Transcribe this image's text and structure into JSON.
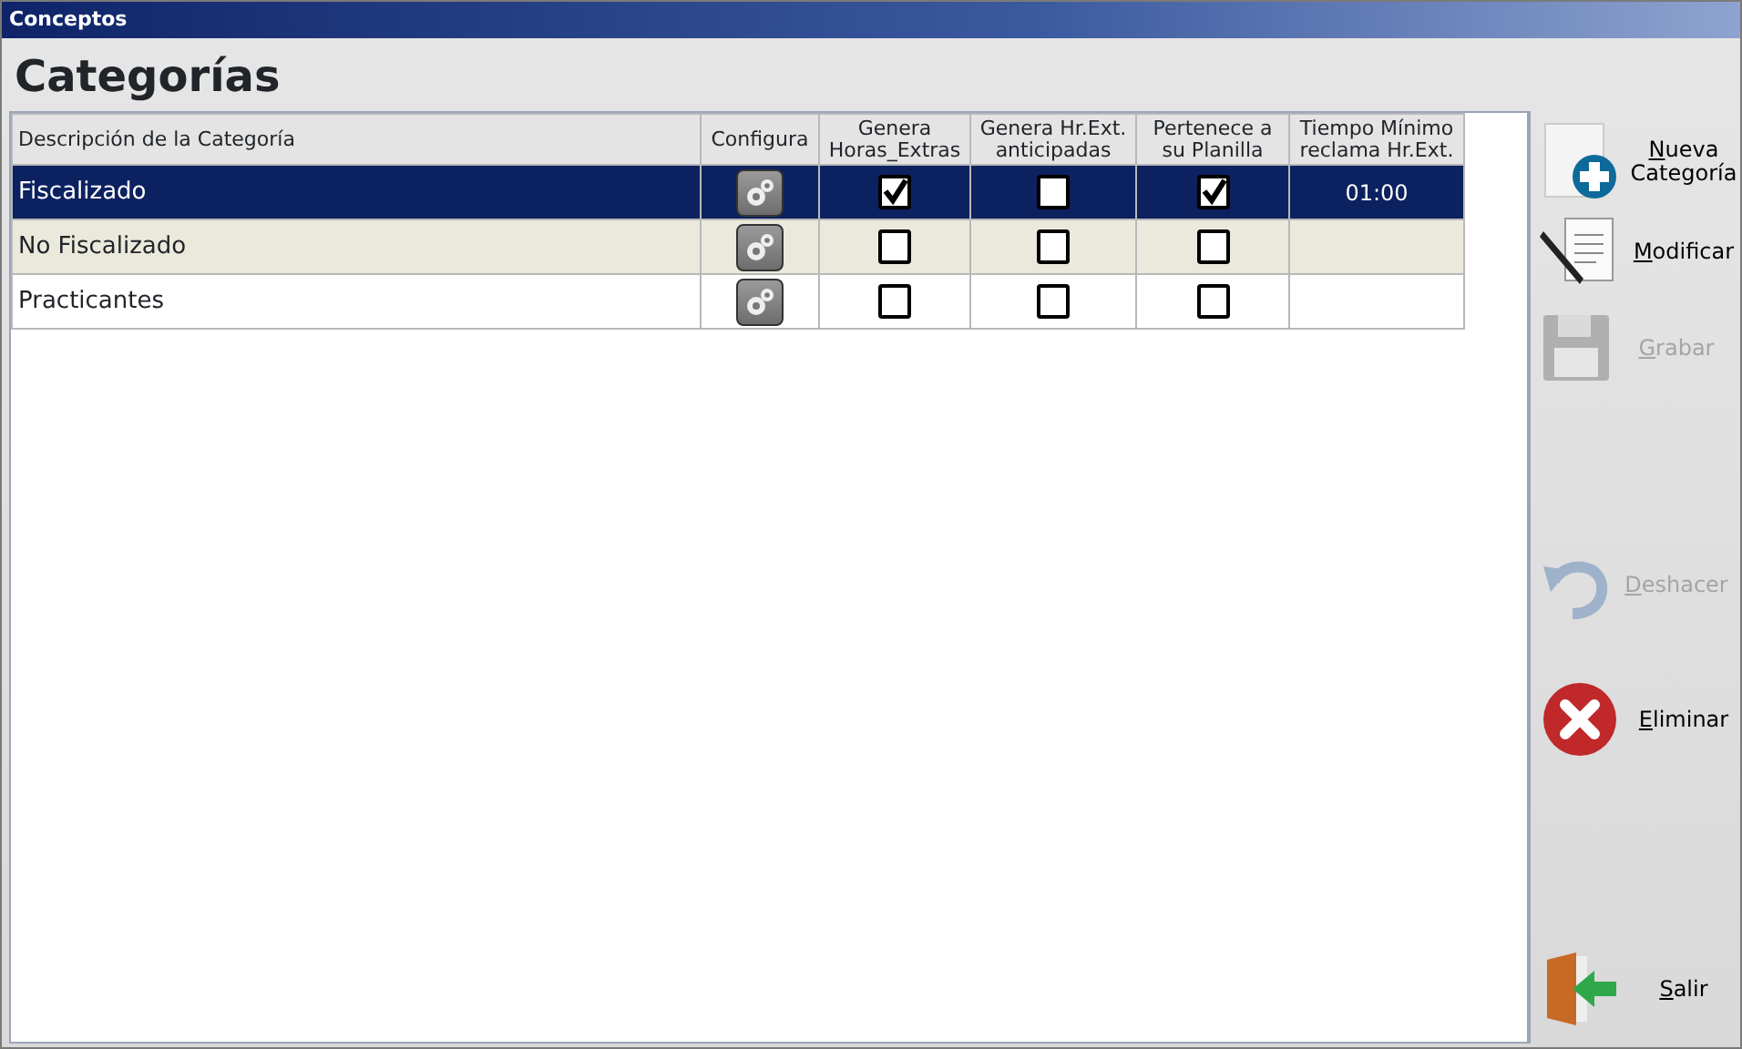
{
  "window": {
    "title": "Conceptos"
  },
  "heading": "Categorías",
  "table": {
    "columns": [
      "Descripción de la Categoría",
      "Configura",
      "Genera Horas_Extras",
      "Genera Hr.Ext. anticipadas",
      "Pertenece a su Planilla",
      "Tiempo Mínimo reclama Hr.Ext."
    ],
    "rows": [
      {
        "description": "Fiscalizado",
        "selected": true,
        "genera_horas_extras": true,
        "genera_anticipadas": false,
        "pertenece_planilla": true,
        "tiempo_minimo": "01:00"
      },
      {
        "description": "No Fiscalizado",
        "selected": false,
        "genera_horas_extras": false,
        "genera_anticipadas": false,
        "pertenece_planilla": false
      },
      {
        "description": "Practicantes",
        "selected": false,
        "genera_horas_extras": false,
        "genera_anticipadas": false,
        "pertenece_planilla": false
      }
    ]
  },
  "actions": [
    {
      "label": "Nueva Categoría",
      "kind": "new",
      "disabled": false,
      "mnemonic": true
    },
    {
      "label": "Modificar",
      "kind": "edit",
      "disabled": false,
      "mnemonic": true
    },
    {
      "label": "Grabar",
      "kind": "save",
      "disabled": true,
      "mnemonic": true
    },
    {
      "label": "Deshacer",
      "kind": "undo",
      "disabled": true,
      "mnemonic": true
    },
    {
      "label": "Eliminar",
      "kind": "delete",
      "disabled": false,
      "mnemonic": true
    },
    {
      "label": "Salir",
      "kind": "exit",
      "disabled": false,
      "mnemonic": true
    }
  ]
}
